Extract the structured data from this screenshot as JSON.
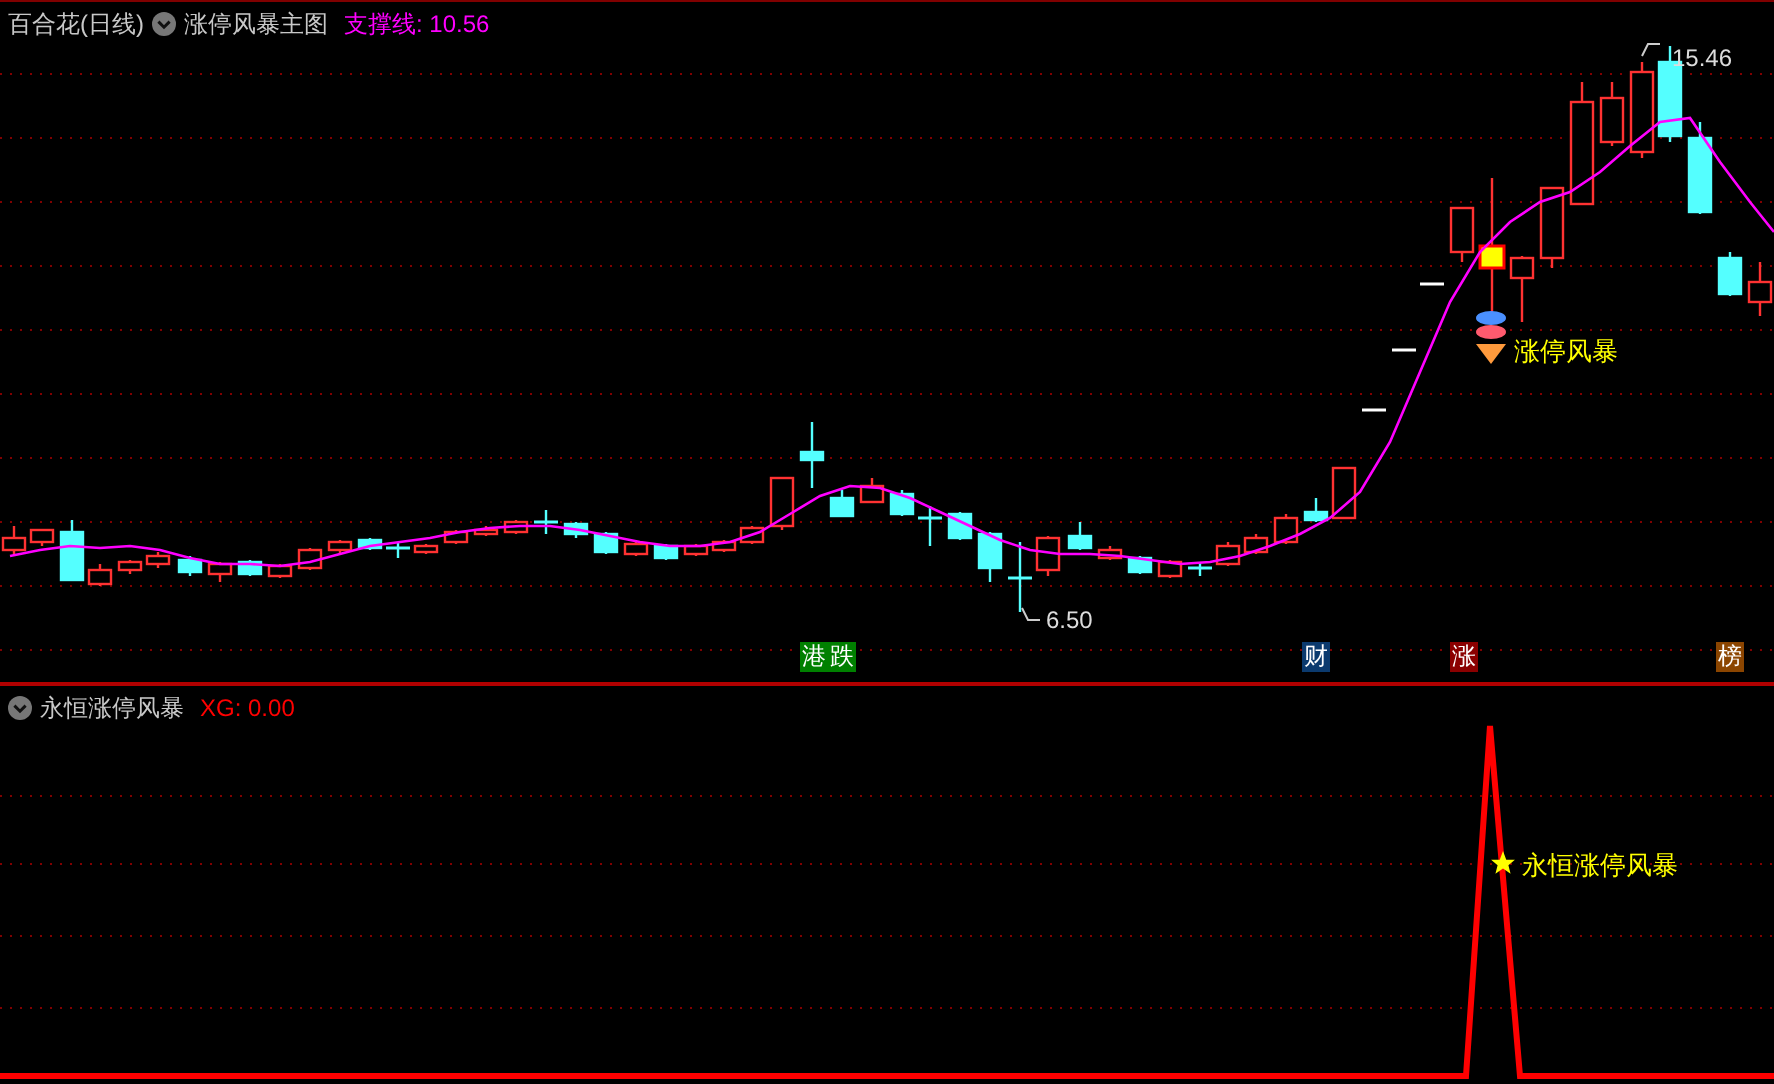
{
  "top_panel": {
    "stock_name": "百合花(日线)",
    "indicator_name": "涨停风暴主图",
    "support_reading": "支撑线: 10.56",
    "high_label": "15.46",
    "low_label": "6.50",
    "signal_label": "涨停风暴",
    "badges": [
      {
        "text": "港",
        "color": "#008000"
      },
      {
        "text": "跌",
        "color": "#008000"
      },
      {
        "text": "财",
        "color": "#0b3a6e"
      },
      {
        "text": "涨",
        "color": "#8b0000"
      },
      {
        "text": "榜",
        "color": "#8b4500"
      }
    ]
  },
  "bottom_panel": {
    "indicator_name": "永恒涨停风暴",
    "xg_reading": "XG: 0.00",
    "signal_label": "永恒涨停风暴"
  }
}
